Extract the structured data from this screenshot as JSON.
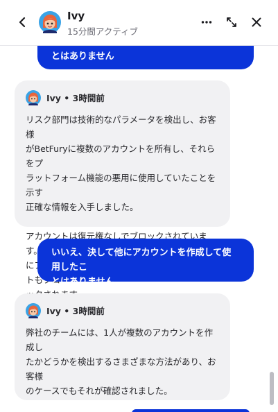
{
  "header": {
    "agent_name": "Ivy",
    "status": "15分間アクティブ",
    "icons": [
      "chevron-left-icon",
      "avatar",
      "more-horizontal-icon",
      "expand-icon",
      "close-icon"
    ]
  },
  "messages": [
    {
      "from": "user",
      "text": "とはありません"
    },
    {
      "from": "agent",
      "author": "Ivy",
      "time": "3時間前",
      "meta": "Ivy • 3時間前",
      "text": "リスク部門は技術的なパラメータを検出し、お客様\nがBetFuryに複数のアカウントを所有し、それらをプ\nラットフォーム機能の悪用に使用していたことを示す\n正確な情報を入手しました。\n\nアカウントは復元権なしでブロックされています。新た\nにアカウントを作成しないでください。アカウントもブロ\nックされます。"
    },
    {
      "from": "user",
      "text": "いいえ、決して他にアカウントを作成して使用したこ\nとはありません"
    },
    {
      "from": "agent",
      "author": "Ivy",
      "time": "3時間前",
      "meta": "Ivy • 3時間前",
      "text": "弊社のチームには、1人が複数のアカウントを作成し\nたかどうかを検出するさまざまな方法があり、お客様\nのケースでもそれが確認されました。"
    }
  ],
  "colors": {
    "user_bubble": "#0b34d9",
    "agent_bubble": "#f1f1f3",
    "header_bg": "#ffffff"
  }
}
